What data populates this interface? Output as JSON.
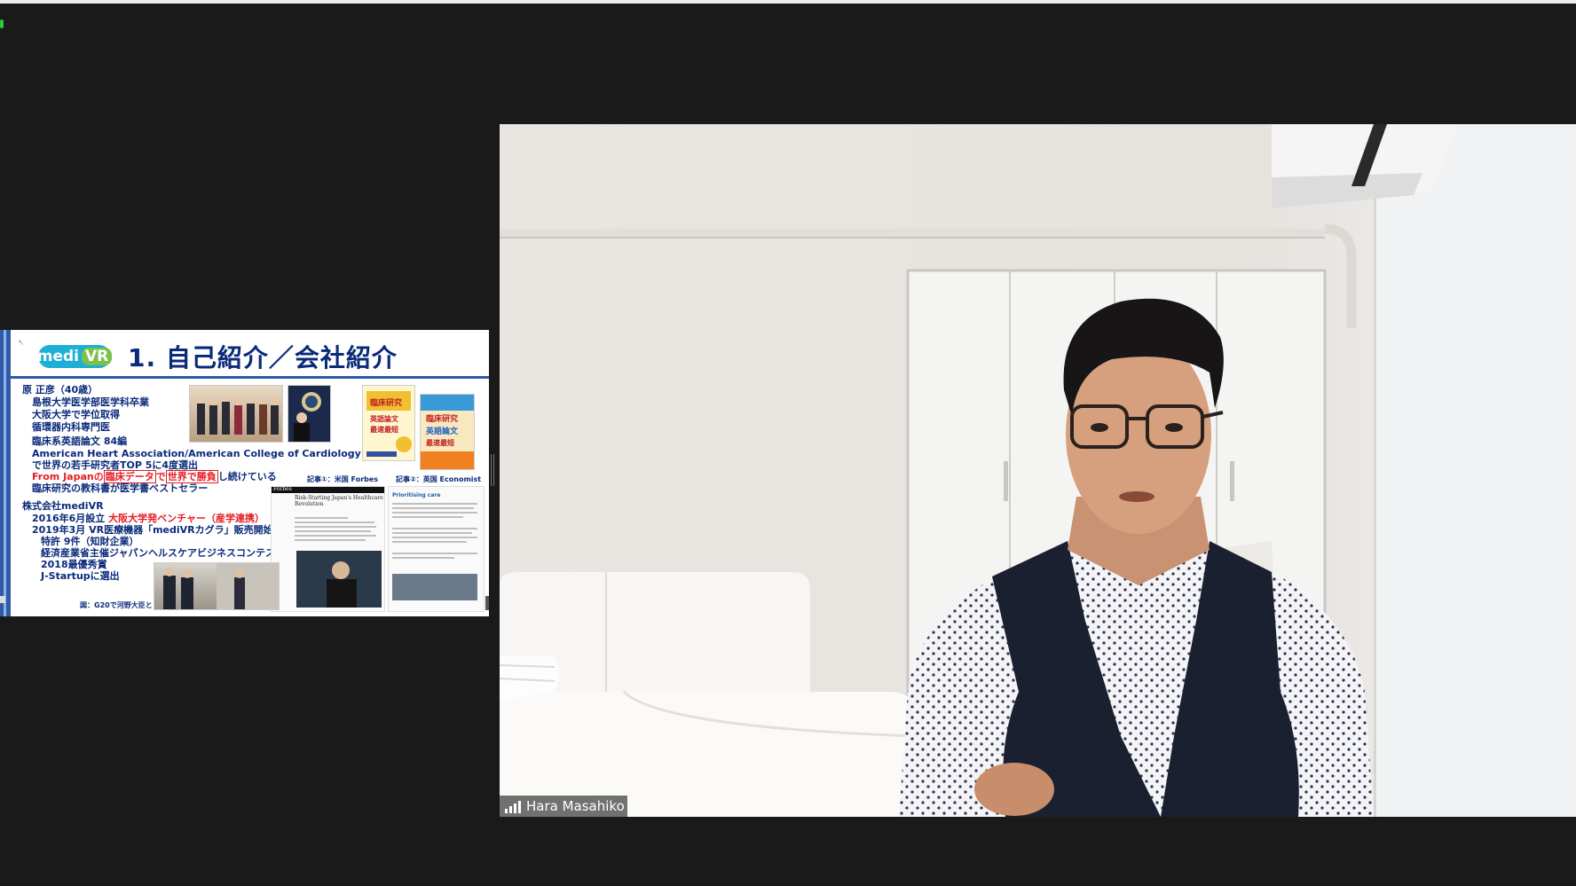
{
  "window": {
    "top_strip_color": "#ececec",
    "background": "#1a1a1a"
  },
  "shared_screen": {
    "logo": {
      "text_a": "medi",
      "text_b": "VR"
    },
    "title": "1. 自己紹介／会社紹介",
    "lines": [
      "原 正彦（40歳）",
      "島根大学医学部医学科卒業",
      "大阪大学で学位取得",
      "循環器内科専門医",
      "臨床系英語論文 84編",
      "American Heart Association/American College of Cardiology",
      "で世界の若手研究者TOP 5に4度選出",
      "臨床研究の教科書が医学書ベストセラー",
      "株式会社mediVR",
      "2019年3月 VR医療機器「mediVRカグラ」販売開始",
      "特許 9件（知財企業）",
      "経済産業省主催ジャパンヘルスケアビジネスコンテスト",
      "2018最優秀賞",
      "J-Startupに選出"
    ],
    "line_red": {
      "a": "From Japanの",
      "b": "臨床データ",
      "c": "で",
      "d": "世界で勝負",
      "e": "し続けている"
    },
    "line_2016": {
      "a": "2016年6月設立 ",
      "b": "大阪大学発ベンチャー（産学連携）"
    },
    "captions": {
      "forbes": "記事①：米国 Forbes",
      "economist": "記事②：英国 Economist",
      "g20": "図：G20で河野大臣と"
    },
    "article_forbes": {
      "brand": "Forbes",
      "headline": "Risk-Starting Japan's Healthcare Revolution"
    },
    "article_economist": {
      "headline": "Prioritising care"
    },
    "book": {
      "title": "臨床研究 英語論文 最速最短 極意"
    }
  },
  "participant": {
    "name": "Hara Masahiko"
  },
  "colors": {
    "accent_blue": "#2f5aa8",
    "title_navy": "#0a2a7a",
    "red": "#e51c23",
    "logo_cyan": "#1eaed6",
    "logo_green": "#7bc24a"
  }
}
